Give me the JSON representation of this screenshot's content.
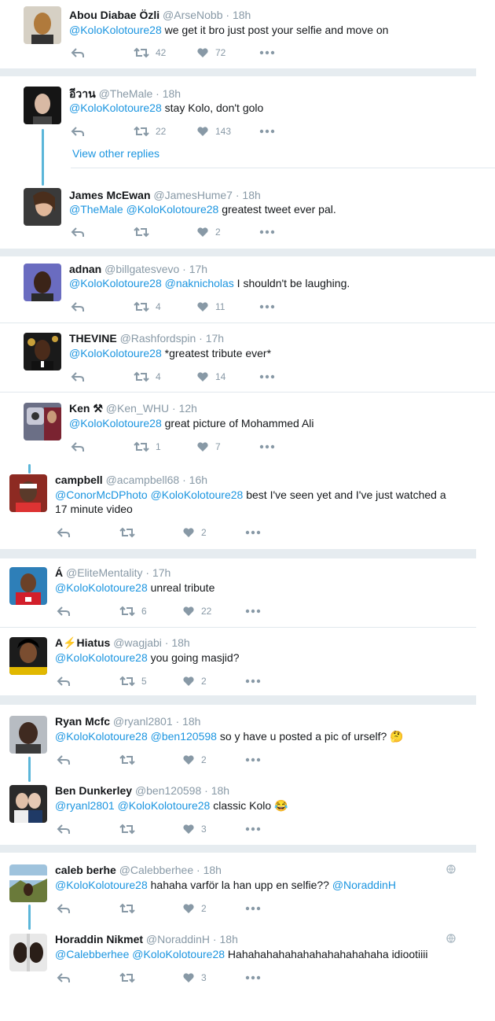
{
  "view_other_replies": "View other replies",
  "tweets": [
    {
      "name": "Abou Diabae Özli",
      "handle": "@ArseNobb",
      "time": "18h",
      "segments": [
        {
          "t": "@KoloKolotoure28",
          "m": true
        },
        {
          "t": " we get it bro just post your selfie and move on",
          "m": false
        }
      ],
      "retweets": "42",
      "likes": "72"
    },
    {
      "name": "อีวาน",
      "handle": "@TheMale",
      "time": "18h",
      "segments": [
        {
          "t": "@KoloKolotoure28",
          "m": true
        },
        {
          "t": " stay Kolo, don't golo",
          "m": false
        }
      ],
      "retweets": "22",
      "likes": "143"
    },
    {
      "name": "James McEwan",
      "handle": "@JamesHume7",
      "time": "18h",
      "segments": [
        {
          "t": "@TheMale",
          "m": true
        },
        {
          "t": " ",
          "m": false
        },
        {
          "t": "@KoloKolotoure28",
          "m": true
        },
        {
          "t": " greatest tweet ever pal.",
          "m": false
        }
      ],
      "retweets": "",
      "likes": "2"
    },
    {
      "name": "adnan",
      "handle": "@billgatesvevo",
      "time": "17h",
      "segments": [
        {
          "t": "@KoloKolotoure28",
          "m": true
        },
        {
          "t": " ",
          "m": false
        },
        {
          "t": "@naknicholas",
          "m": true
        },
        {
          "t": " I shouldn't be laughing.",
          "m": false
        }
      ],
      "retweets": "4",
      "likes": "11"
    },
    {
      "name": "THEVINE",
      "handle": "@Rashfordspin",
      "time": "17h",
      "segments": [
        {
          "t": "@KoloKolotoure28",
          "m": true
        },
        {
          "t": " *greatest tribute ever*",
          "m": false
        }
      ],
      "retweets": "4",
      "likes": "14"
    },
    {
      "name": "Ken ⚒",
      "handle": "@Ken_WHU",
      "time": "12h",
      "segments": [
        {
          "t": "@KoloKolotoure28",
          "m": true
        },
        {
          "t": " great picture of Mohammed Ali",
          "m": false
        }
      ],
      "retweets": "1",
      "likes": "7"
    },
    {
      "name": "campbell",
      "handle": "@acampbell68",
      "time": "16h",
      "segments": [
        {
          "t": "@ConorMcDPhoto",
          "m": true
        },
        {
          "t": " ",
          "m": false
        },
        {
          "t": "@KoloKolotoure28",
          "m": true
        },
        {
          "t": " best I've seen yet and I've just watched a 17 minute video",
          "m": false
        }
      ],
      "retweets": "",
      "likes": "2"
    },
    {
      "name": "Á",
      "handle": "@EliteMentality",
      "time": "17h",
      "segments": [
        {
          "t": "@KoloKolotoure28",
          "m": true
        },
        {
          "t": " unreal tribute",
          "m": false
        }
      ],
      "retweets": "6",
      "likes": "22"
    },
    {
      "name": "A⚡Hiatus",
      "handle": "@wagjabi",
      "time": "18h",
      "segments": [
        {
          "t": "@KoloKolotoure28",
          "m": true
        },
        {
          "t": " you going masjid?",
          "m": false
        }
      ],
      "retweets": "5",
      "likes": "2"
    },
    {
      "name": "Ryan Mcfc",
      "handle": "@ryanl2801",
      "time": "18h",
      "segments": [
        {
          "t": "@KoloKolotoure28",
          "m": true
        },
        {
          "t": " ",
          "m": false
        },
        {
          "t": "@ben120598",
          "m": true
        },
        {
          "t": " so y have u posted a pic of urself? 🤔",
          "m": false
        }
      ],
      "retweets": "",
      "likes": "2"
    },
    {
      "name": "Ben Dunkerley",
      "handle": "@ben120598",
      "time": "18h",
      "segments": [
        {
          "t": "@ryanl2801",
          "m": true
        },
        {
          "t": " ",
          "m": false
        },
        {
          "t": "@KoloKolotoure28",
          "m": true
        },
        {
          "t": " classic Kolo 😂",
          "m": false
        }
      ],
      "retweets": "",
      "likes": "3"
    },
    {
      "name": "caleb berhe",
      "handle": "@Calebberhee",
      "time": "18h",
      "segments": [
        {
          "t": "@KoloKolotoure28",
          "m": true
        },
        {
          "t": " hahaha varför la han upp en selfie?? ",
          "m": false
        },
        {
          "t": "@NoraddinH",
          "m": true
        }
      ],
      "retweets": "",
      "likes": "2"
    },
    {
      "name": "Horaddin Nikmet",
      "handle": "@NoraddinH",
      "time": "18h",
      "segments": [
        {
          "t": "@Calebberhee",
          "m": true
        },
        {
          "t": " ",
          "m": false
        },
        {
          "t": "@KoloKolotoure28",
          "m": true
        },
        {
          "t": " Hahahahahahahahahahahahaha idiootiiii",
          "m": false
        }
      ],
      "retweets": "",
      "likes": "3"
    }
  ],
  "colors": {
    "link": "#1b95e0",
    "thread_line": "#5bb6d9",
    "muted": "#8899a6",
    "separator": "#e6ecf0"
  }
}
